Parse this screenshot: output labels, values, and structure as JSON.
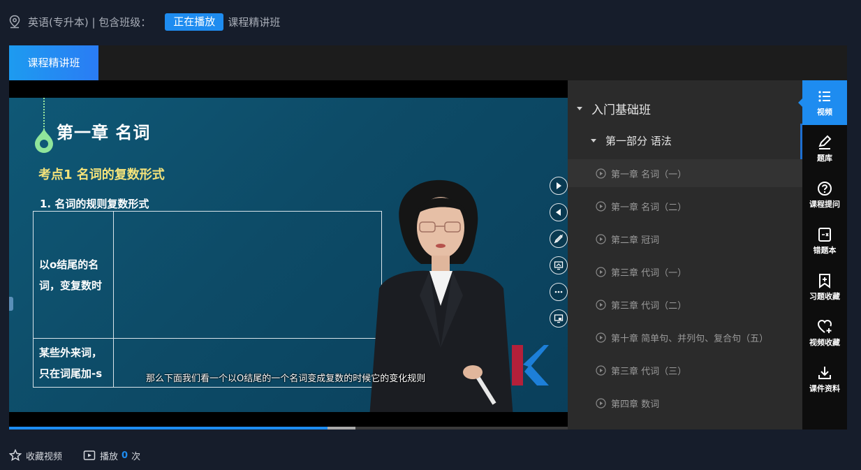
{
  "header": {
    "course": "英语(专升本) | 包含班级：",
    "status_badge": "正在播放",
    "class_name": "课程精讲班"
  },
  "tabs": [
    {
      "label": "课程精讲班",
      "active": true
    }
  ],
  "video": {
    "slide": {
      "chapter_title": "第一章  名词",
      "key_point": "考点1  名词的复数形式",
      "rule_heading": "1. 名词的规则复数形式",
      "table_rows": [
        {
          "label_line1": "以o结尾的名",
          "label_line2": "词，变复数时"
        },
        {
          "label_line1": "某些外来词，",
          "label_line2": "只在词尾加-s"
        }
      ]
    },
    "subtitle": "那么下面我们看一个以O结尾的一个名词变成复数的时候它的变化规则",
    "progress": {
      "played_fraction": 0.57,
      "buffered_fraction": 0.62
    },
    "tool_icons": [
      "play-circle-icon",
      "rewind-icon",
      "pen-icon",
      "screen-icon",
      "more-icon",
      "pip-icon"
    ]
  },
  "playlist": {
    "section": "入门基础班",
    "subsection": "第一部分  语法",
    "items": [
      {
        "title": "第一章  名词（一）",
        "active": true
      },
      {
        "title": "第一章  名词（二）",
        "active": false
      },
      {
        "title": "第二章  冠词",
        "active": false
      },
      {
        "title": "第三章  代词（一）",
        "active": false
      },
      {
        "title": "第三章  代词（二）",
        "active": false
      },
      {
        "title": "第十章  简单句、并列句、复合句（五）",
        "active": false
      },
      {
        "title": "第三章  代词（三）",
        "active": false
      },
      {
        "title": "第四章  数词",
        "active": false
      }
    ]
  },
  "sidebar": {
    "items": [
      {
        "label": "视频",
        "icon": "list-icon",
        "active": true
      },
      {
        "label": "题库",
        "icon": "edit-icon",
        "active": false
      },
      {
        "label": "课程提问",
        "icon": "question-icon",
        "active": false
      },
      {
        "label": "错题本",
        "icon": "wrongbook-icon",
        "active": false
      },
      {
        "label": "习题收藏",
        "icon": "bookmark-add-icon",
        "active": false
      },
      {
        "label": "视频收藏",
        "icon": "heart-add-icon",
        "active": false
      },
      {
        "label": "课件资料",
        "icon": "download-icon",
        "active": false
      }
    ]
  },
  "footer": {
    "favorite_label": "收藏视频",
    "play_label": "播放",
    "play_count": "0",
    "play_unit": "次"
  },
  "colors": {
    "accent": "#1e8cf0",
    "background": "#161d2b",
    "panel": "#2b2b2b",
    "sidebar": "#0d0d0d"
  }
}
